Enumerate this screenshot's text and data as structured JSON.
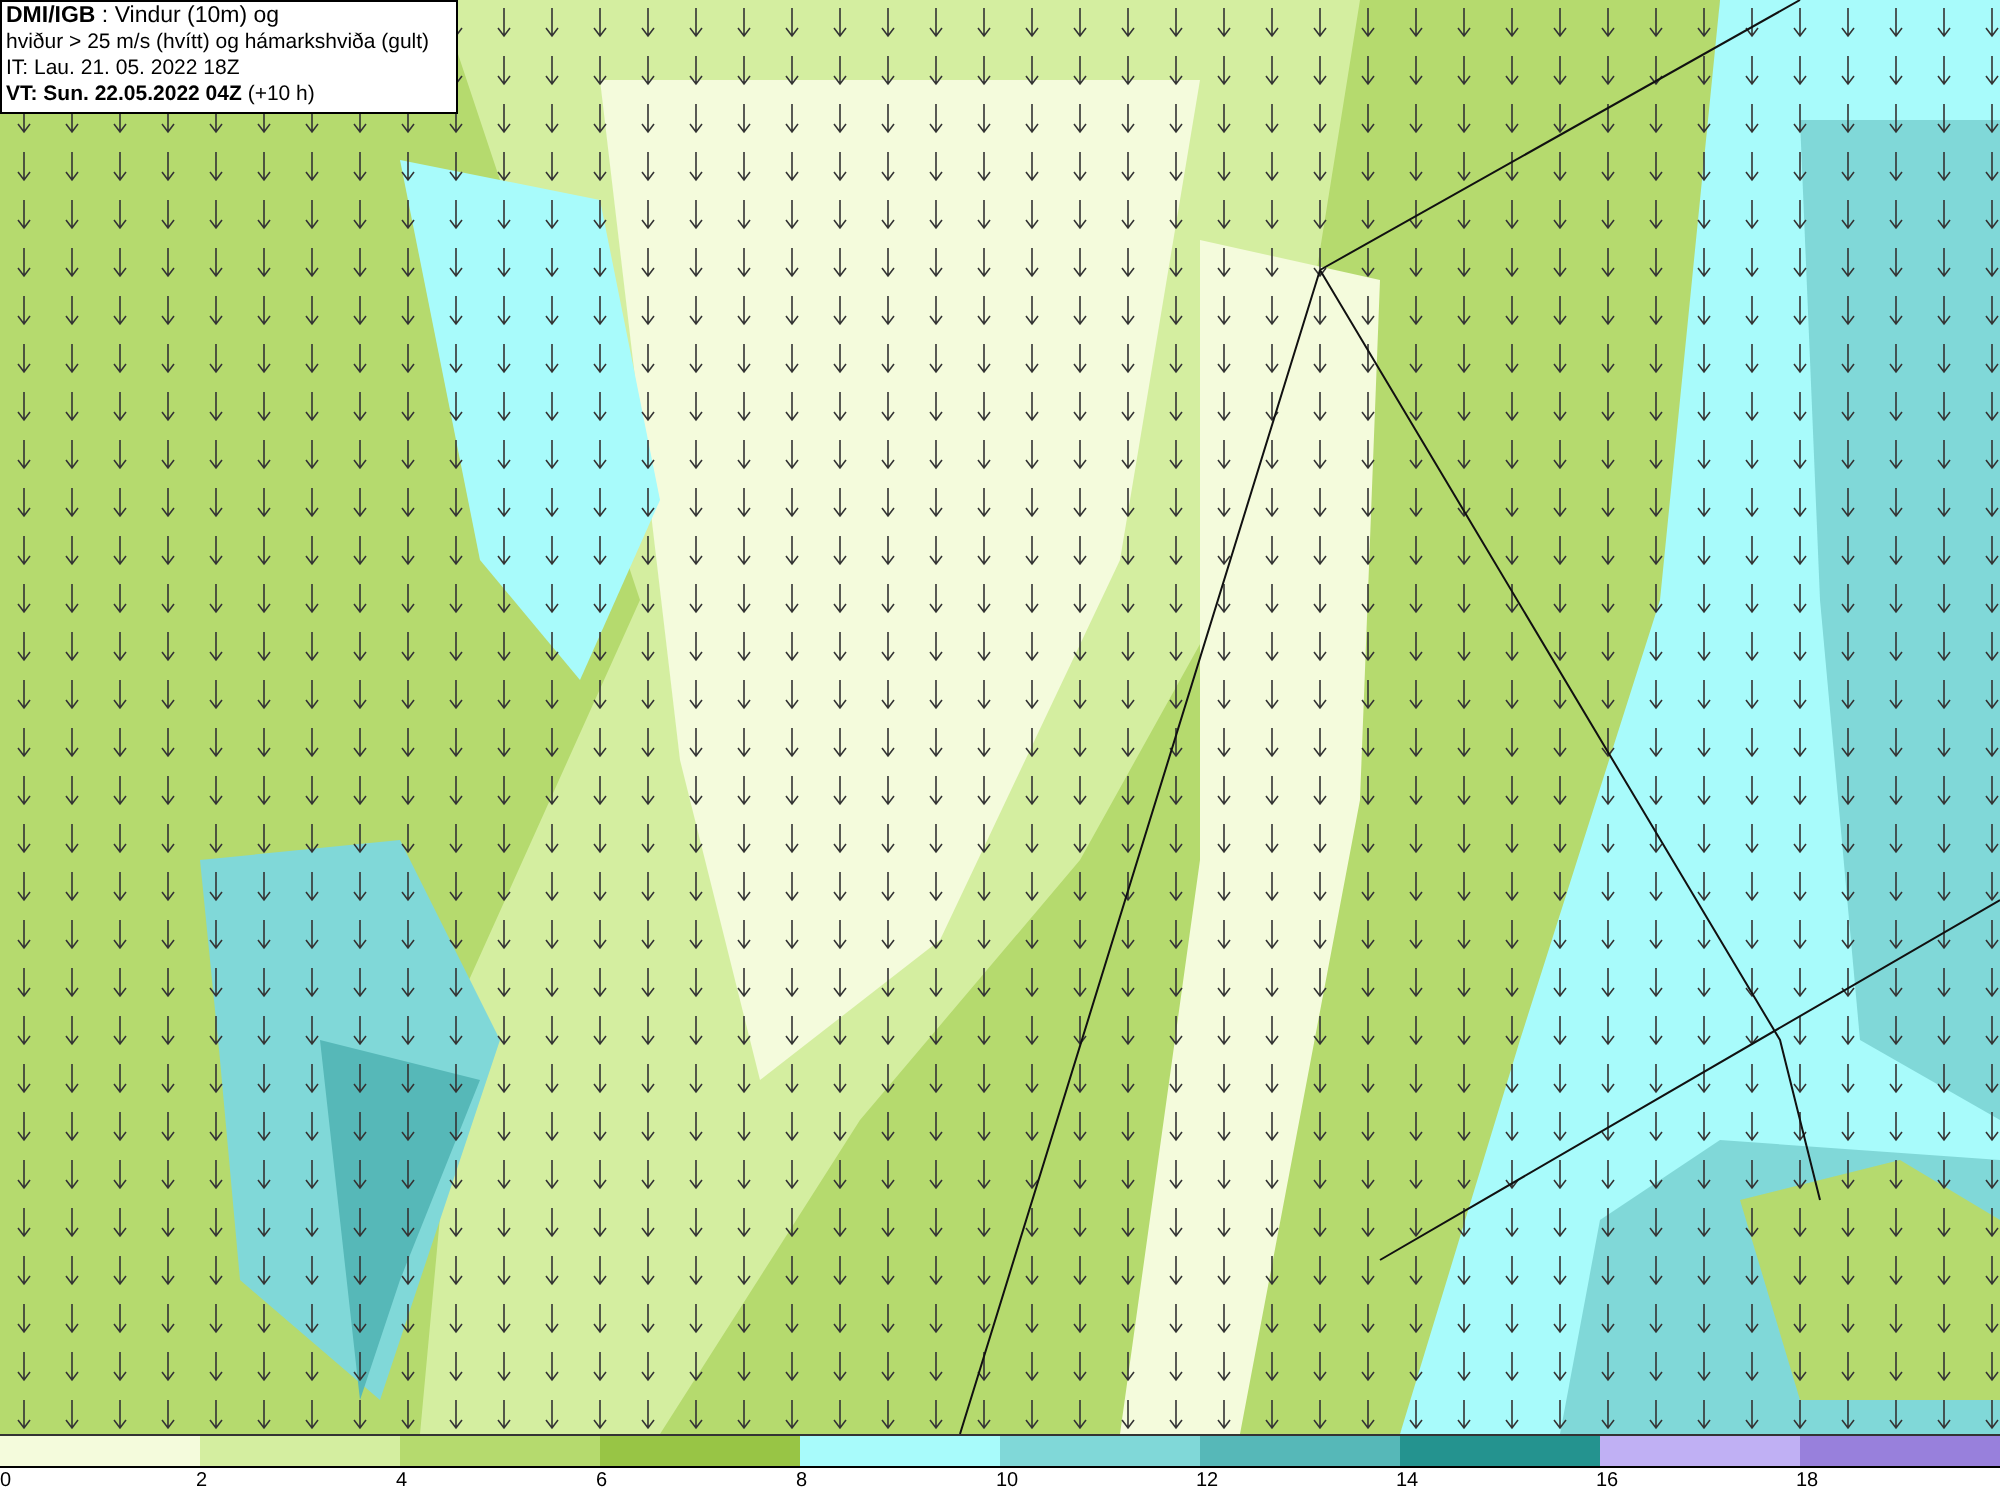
{
  "title_box": {
    "lines": [
      "**DMI/IGB** : Vindur (10m) og",
      "hviður > 25 m/s (hvítt) og hámarkshviða (gult)",
      "IT: Lau. 21. 05. 2022 18Z",
      "**VT: Sun. 22.05.2022 04Z** (+10 h)"
    ]
  },
  "legend": [
    {
      "label": "0",
      "color": "#f4fbdc"
    },
    {
      "label": "2",
      "color": "#d4eea0"
    },
    {
      "label": "4",
      "color": "#b5da6e"
    },
    {
      "label": "6",
      "color": "#98c545"
    },
    {
      "label": "8",
      "color": "#a8fbfb"
    },
    {
      "label": "10",
      "color": "#80d8d8"
    },
    {
      "label": "12",
      "color": "#56b8b8"
    },
    {
      "label": "14",
      "color": "#24938f"
    },
    {
      "label": "16",
      "color": "#c0b0f4"
    },
    {
      "label": "18",
      "color": "#9880dc"
    }
  ]
}
